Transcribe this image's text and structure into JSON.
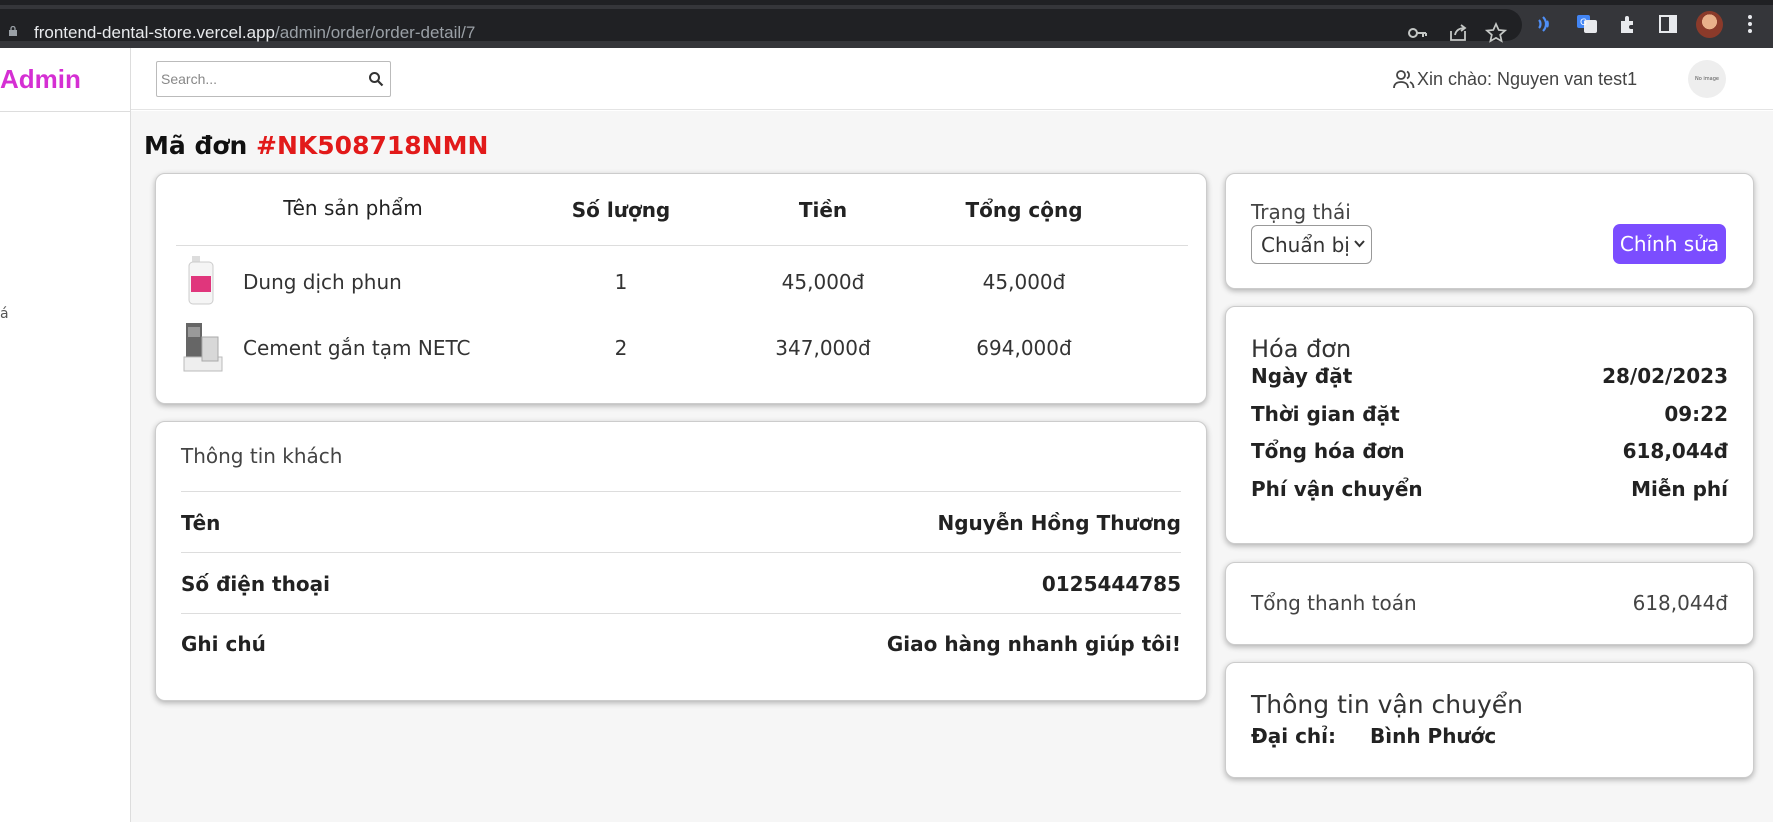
{
  "browser": {
    "url_host": "frontend-dental-store.vercel.app",
    "url_path": "/admin/order/order-detail/7"
  },
  "sidebar": {
    "brand": "Admin",
    "fragment": "á"
  },
  "header": {
    "search_placeholder": "Search...",
    "greeting": "Xin chào: Nguyen van test1",
    "avatar_text": "No image"
  },
  "order": {
    "title_prefix": "Mã đơn",
    "code": "#NK508718NMN"
  },
  "products": {
    "columns": [
      "Tên sản phẩm",
      "Số lượng",
      "Tiền",
      "Tổng cộng"
    ],
    "rows": [
      {
        "name": "Dung dịch phun",
        "qty": "1",
        "price": "45,000đ",
        "total": "45,000đ"
      },
      {
        "name": "Cement gắn tạm NETC",
        "qty": "2",
        "price": "347,000đ",
        "total": "694,000đ"
      }
    ]
  },
  "customer": {
    "title": "Thông tin khách",
    "fields": [
      {
        "label": "Tên",
        "value": "Nguyễn Hồng Thương"
      },
      {
        "label": "Số điện thoại",
        "value": "0125444785"
      },
      {
        "label": "Ghi chú",
        "value": "Giao hàng nhanh giúp tôi!"
      }
    ]
  },
  "status": {
    "label": "Trạng thái",
    "selected": "Chuẩn bị",
    "edit_label": "Chỉnh sửa",
    "accent_color": "#7b4dff"
  },
  "invoice": {
    "title": "Hóa đơn",
    "fields": [
      {
        "label": "Ngày đặt",
        "value": "28/02/2023"
      },
      {
        "label": "Thời gian đặt",
        "value": "09:22"
      },
      {
        "label": "Tổng hóa đơn",
        "value": "618,044đ"
      },
      {
        "label": "Phí vận chuyển",
        "value": "Miễn phí"
      }
    ]
  },
  "payment": {
    "label": "Tổng thanh toán",
    "value": "618,044đ"
  },
  "shipping": {
    "title": "Thông tin vận chuyển",
    "address_label": "Đại chỉ:",
    "address_value": "Bình Phước"
  }
}
